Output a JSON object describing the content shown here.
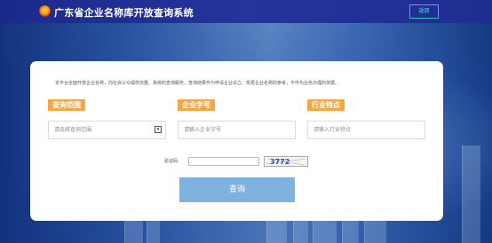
{
  "header": {
    "title": "广东省企业名称库开放查询系统",
    "back_label": "返回"
  },
  "card": {
    "notice": "本平台全面开放企业名称，向社会公众提供完整、系统的查询服务，查询结果作为申请企业设立、变更企业名称的参考，不作为业务办理的依据。",
    "fields": [
      {
        "label": "查询范围",
        "value": "请选择查询范围"
      },
      {
        "label": "企业字号",
        "placeholder": "请输入企业字号"
      },
      {
        "label": "行业特点",
        "placeholder": "请输入行业特点"
      }
    ],
    "captcha": {
      "label": "验证码:",
      "value": "",
      "image_text": "3772"
    },
    "search_label": "查询"
  },
  "colors": {
    "topbar": "#1f2d90",
    "label_orange": "#f0a948",
    "button_blue": "#7fb2dd",
    "back_border": "#2bc0b5"
  }
}
